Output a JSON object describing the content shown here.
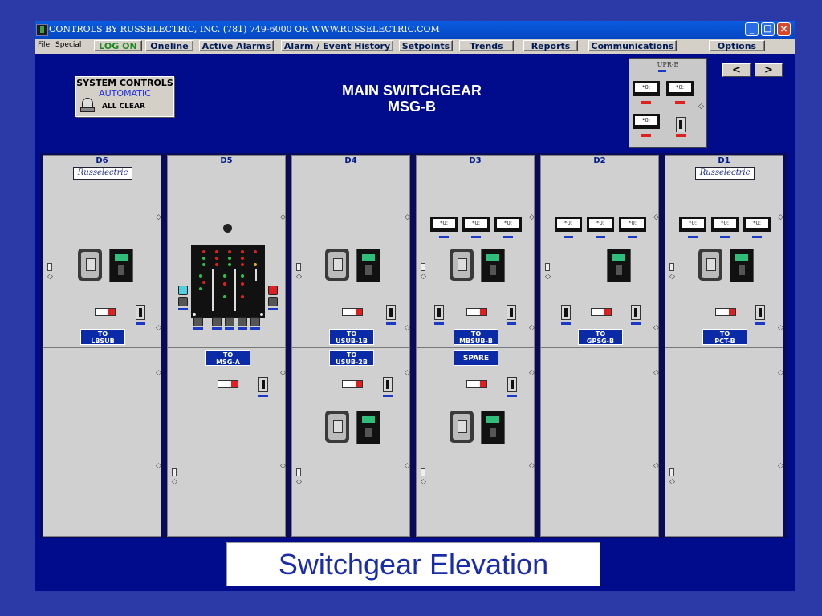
{
  "window": {
    "title": "CONTROLS BY RUSSELECTRIC, INC. (781) 749-6000 OR WWW.RUSSELECTRIC.COM",
    "buttons": {
      "minimize": "_",
      "restore": "❐",
      "close": "✕"
    }
  },
  "menu": {
    "text_items": [
      "File",
      "Special"
    ],
    "buttons": [
      "LOG ON",
      "Oneline",
      "Active Alarms",
      "Alarm / Event History",
      "Setpoints",
      "Trends",
      "Reports",
      "Communications",
      "Options"
    ]
  },
  "system_controls": {
    "title": "SYSTEM CONTROLS",
    "mode": "AUTOMATIC",
    "status": "ALL CLEAR"
  },
  "heading": {
    "line1": "MAIN SWITCHGEAR",
    "line2": "MSG-B"
  },
  "upr_b": {
    "label": "UPR-B"
  },
  "nav": {
    "prev": "<",
    "next": ">"
  },
  "logo_text": "Russelectric",
  "panels": [
    {
      "id": "D6",
      "upper_label": "TO\nLBSUB",
      "lower_label": ""
    },
    {
      "id": "D5",
      "upper_label": "",
      "lower_label": "TO\nMSG-A"
    },
    {
      "id": "D4",
      "upper_label": "TO\nUSUB-1B",
      "lower_label": "TO\nUSUB-2B"
    },
    {
      "id": "D3",
      "upper_label": "TO\nMBSUB-B",
      "lower_label": "SPARE"
    },
    {
      "id": "D2",
      "upper_label": "TO\nGPSG-B",
      "lower_label": ""
    },
    {
      "id": "D1",
      "upper_label": "TO\nPCT-B",
      "lower_label": ""
    }
  ],
  "meter_face": "*0:",
  "caption": "Switchgear Elevation",
  "colors": {
    "background": "#2b3aa6",
    "panel_bg": "#000c8c",
    "accent_red": "#e02020",
    "accent_blue": "#1b39c8"
  }
}
